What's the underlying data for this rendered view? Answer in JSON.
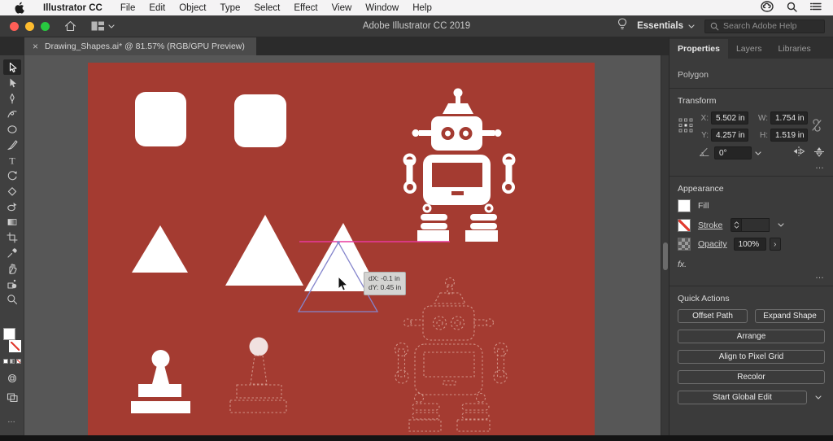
{
  "window": {
    "title": "Adobe Illustrator CC 2019"
  },
  "menubar": {
    "app_name": "Illustrator CC",
    "items": [
      "File",
      "Edit",
      "Object",
      "Type",
      "Select",
      "Effect",
      "View",
      "Window",
      "Help"
    ]
  },
  "titlebar": {
    "workspace": "Essentials",
    "search_placeholder": "Search Adobe Help"
  },
  "document_tab": {
    "close": "×",
    "label": "Drawing_Shapes.ai* @ 81.57% (RGB/GPU Preview)"
  },
  "toolbar": {
    "tools": [
      "selection",
      "direct-selection",
      "pen",
      "curvature",
      "ellipse",
      "paintbrush",
      "type",
      "rotate",
      "eraser",
      "shape-builder",
      "gradient",
      "artboard",
      "eyedropper",
      "hand",
      "symbol-sprayer",
      "zoom"
    ],
    "more": "…"
  },
  "canvas": {
    "tooltip_dx": "dX: -0.1 in",
    "tooltip_dy": "dY: 0.45 in"
  },
  "panel": {
    "tabs": [
      "Properties",
      "Layers",
      "Libraries"
    ],
    "selected_object_type": "Polygon",
    "transform": {
      "heading": "Transform",
      "x_label": "X:",
      "x_value": "5.502 in",
      "y_label": "Y:",
      "y_value": "4.257 in",
      "w_label": "W:",
      "w_value": "1.754 in",
      "h_label": "H:",
      "h_value": "1.519 in",
      "angle_value": "0°",
      "more": "…"
    },
    "appearance": {
      "heading": "Appearance",
      "fill_label": "Fill",
      "stroke_label": "Stroke",
      "opacity_label": "Opacity",
      "opacity_value": "100%",
      "opacity_arrow": "›",
      "fx_label": "fx.",
      "more": "…"
    },
    "quick_actions": {
      "heading": "Quick Actions",
      "buttons": [
        "Offset Path",
        "Expand Shape",
        "Arrange",
        "Align to Pixel Grid",
        "Recolor",
        "Start Global Edit"
      ]
    }
  },
  "colors": {
    "artboard_red": "#a43b31",
    "smart_guide_magenta": "#e8399e",
    "selection_outline_blue": "#8585cc",
    "traffic_red": "#ff5f57",
    "traffic_yellow": "#febc2e",
    "traffic_green": "#28c840"
  }
}
